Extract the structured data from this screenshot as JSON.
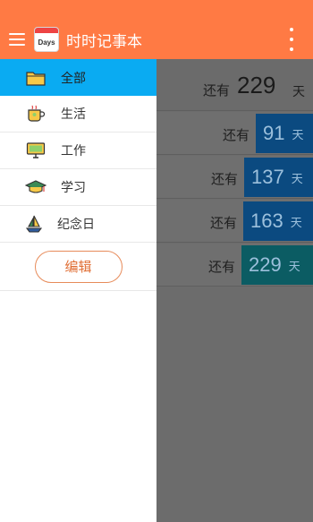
{
  "app": {
    "title": "时时记事本",
    "logo_text": "Days"
  },
  "drawer": {
    "items": [
      {
        "label": "全部",
        "icon": "folder-icon"
      },
      {
        "label": "生活",
        "icon": "coffee-cup-icon"
      },
      {
        "label": "工作",
        "icon": "monitor-icon"
      },
      {
        "label": "学习",
        "icon": "graduation-cap-icon"
      },
      {
        "label": "纪念日",
        "icon": "sailboat-icon"
      }
    ],
    "edit_label": "编辑"
  },
  "list": {
    "rows": [
      {
        "prefix": "还有",
        "days": "229",
        "unit": "天"
      },
      {
        "prefix": "还有",
        "days": "91",
        "unit": "天"
      },
      {
        "prefix": "还有",
        "days": "137",
        "unit": "天"
      },
      {
        "prefix": "还有",
        "days": "163",
        "unit": "天"
      },
      {
        "prefix": "还有",
        "days": "229",
        "unit": "天"
      }
    ]
  },
  "colors": {
    "accent": "#ff7a44",
    "selected": "#0aabf2",
    "day_box": "#0b4a80",
    "day_box_alt": "#0b5c63",
    "edit_border": "#e78b5a"
  }
}
